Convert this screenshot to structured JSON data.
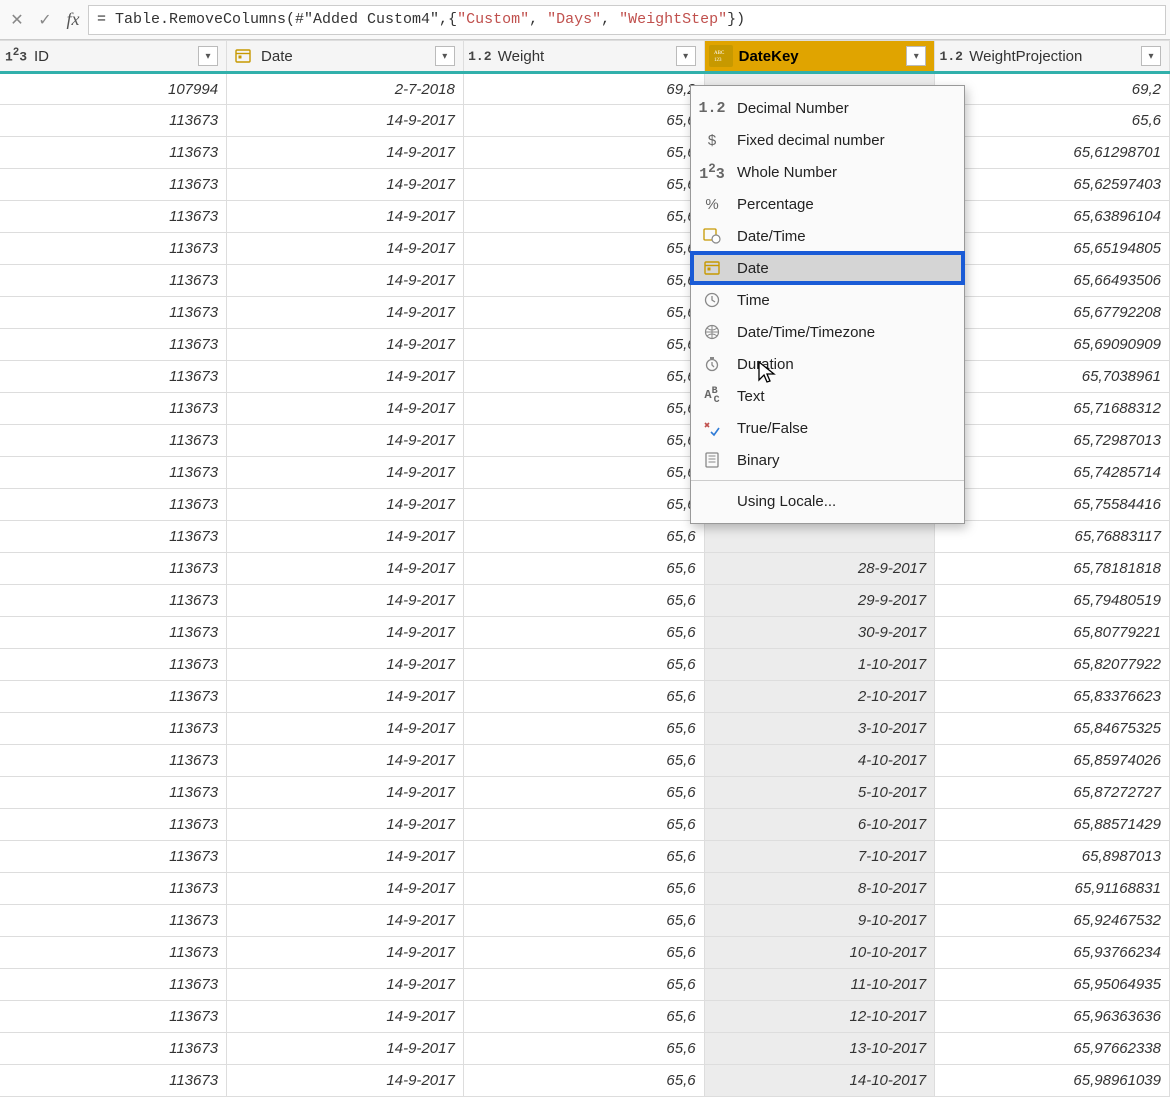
{
  "formula": {
    "prefix": "= Table.RemoveColumns(#\"Added Custom4\",{",
    "s1": "\"Custom\"",
    "sep1": ", ",
    "s2": "\"Days\"",
    "sep2": ", ",
    "s3": "\"WeightStep\"",
    "suffix": "})"
  },
  "columns": {
    "c0": {
      "name": "ID",
      "type": "1²3"
    },
    "c1": {
      "name": "Date",
      "type": "date"
    },
    "c2": {
      "name": "Weight",
      "type": "1.2"
    },
    "c3": {
      "name": "DateKey",
      "type": "abc123"
    },
    "c4": {
      "name": "WeightProjection",
      "type": "1.2"
    }
  },
  "menu": {
    "m0": "Decimal Number",
    "m1": "Fixed decimal number",
    "m2": "Whole Number",
    "m3": "Percentage",
    "m4": "Date/Time",
    "m5": "Date",
    "m6": "Time",
    "m7": "Date/Time/Timezone",
    "m8": "Duration",
    "m9": "Text",
    "m10": "True/False",
    "m11": "Binary",
    "m12": "Using Locale..."
  },
  "rows": [
    {
      "id": "107994",
      "date": "2-7-2018",
      "w": "69,2",
      "dk": "",
      "wp": "69,2"
    },
    {
      "id": "113673",
      "date": "14-9-2017",
      "w": "65,6",
      "dk": "",
      "wp": "65,6"
    },
    {
      "id": "113673",
      "date": "14-9-2017",
      "w": "65,6",
      "dk": "",
      "wp": "65,61298701"
    },
    {
      "id": "113673",
      "date": "14-9-2017",
      "w": "65,6",
      "dk": "",
      "wp": "65,62597403"
    },
    {
      "id": "113673",
      "date": "14-9-2017",
      "w": "65,6",
      "dk": "",
      "wp": "65,63896104"
    },
    {
      "id": "113673",
      "date": "14-9-2017",
      "w": "65,6",
      "dk": "",
      "wp": "65,65194805"
    },
    {
      "id": "113673",
      "date": "14-9-2017",
      "w": "65,6",
      "dk": "",
      "wp": "65,66493506"
    },
    {
      "id": "113673",
      "date": "14-9-2017",
      "w": "65,6",
      "dk": "",
      "wp": "65,67792208"
    },
    {
      "id": "113673",
      "date": "14-9-2017",
      "w": "65,6",
      "dk": "",
      "wp": "65,69090909"
    },
    {
      "id": "113673",
      "date": "14-9-2017",
      "w": "65,6",
      "dk": "",
      "wp": "65,7038961"
    },
    {
      "id": "113673",
      "date": "14-9-2017",
      "w": "65,6",
      "dk": "",
      "wp": "65,71688312"
    },
    {
      "id": "113673",
      "date": "14-9-2017",
      "w": "65,6",
      "dk": "",
      "wp": "65,72987013"
    },
    {
      "id": "113673",
      "date": "14-9-2017",
      "w": "65,6",
      "dk": "",
      "wp": "65,74285714"
    },
    {
      "id": "113673",
      "date": "14-9-2017",
      "w": "65,6",
      "dk": "",
      "wp": "65,75584416"
    },
    {
      "id": "113673",
      "date": "14-9-2017",
      "w": "65,6",
      "dk": "",
      "wp": "65,76883117"
    },
    {
      "id": "113673",
      "date": "14-9-2017",
      "w": "65,6",
      "dk": "28-9-2017",
      "wp": "65,78181818"
    },
    {
      "id": "113673",
      "date": "14-9-2017",
      "w": "65,6",
      "dk": "29-9-2017",
      "wp": "65,79480519"
    },
    {
      "id": "113673",
      "date": "14-9-2017",
      "w": "65,6",
      "dk": "30-9-2017",
      "wp": "65,80779221"
    },
    {
      "id": "113673",
      "date": "14-9-2017",
      "w": "65,6",
      "dk": "1-10-2017",
      "wp": "65,82077922"
    },
    {
      "id": "113673",
      "date": "14-9-2017",
      "w": "65,6",
      "dk": "2-10-2017",
      "wp": "65,83376623"
    },
    {
      "id": "113673",
      "date": "14-9-2017",
      "w": "65,6",
      "dk": "3-10-2017",
      "wp": "65,84675325"
    },
    {
      "id": "113673",
      "date": "14-9-2017",
      "w": "65,6",
      "dk": "4-10-2017",
      "wp": "65,85974026"
    },
    {
      "id": "113673",
      "date": "14-9-2017",
      "w": "65,6",
      "dk": "5-10-2017",
      "wp": "65,87272727"
    },
    {
      "id": "113673",
      "date": "14-9-2017",
      "w": "65,6",
      "dk": "6-10-2017",
      "wp": "65,88571429"
    },
    {
      "id": "113673",
      "date": "14-9-2017",
      "w": "65,6",
      "dk": "7-10-2017",
      "wp": "65,8987013"
    },
    {
      "id": "113673",
      "date": "14-9-2017",
      "w": "65,6",
      "dk": "8-10-2017",
      "wp": "65,91168831"
    },
    {
      "id": "113673",
      "date": "14-9-2017",
      "w": "65,6",
      "dk": "9-10-2017",
      "wp": "65,92467532"
    },
    {
      "id": "113673",
      "date": "14-9-2017",
      "w": "65,6",
      "dk": "10-10-2017",
      "wp": "65,93766234"
    },
    {
      "id": "113673",
      "date": "14-9-2017",
      "w": "65,6",
      "dk": "11-10-2017",
      "wp": "65,95064935"
    },
    {
      "id": "113673",
      "date": "14-9-2017",
      "w": "65,6",
      "dk": "12-10-2017",
      "wp": "65,96363636"
    },
    {
      "id": "113673",
      "date": "14-9-2017",
      "w": "65,6",
      "dk": "13-10-2017",
      "wp": "65,97662338"
    },
    {
      "id": "113673",
      "date": "14-9-2017",
      "w": "65,6",
      "dk": "14-10-2017",
      "wp": "65,98961039"
    }
  ]
}
